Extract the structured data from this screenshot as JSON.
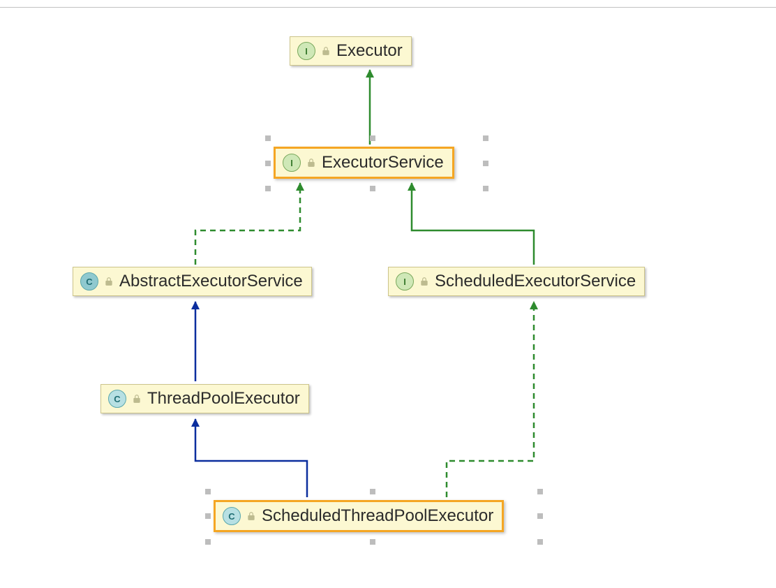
{
  "diagram": {
    "nodes": {
      "executor": {
        "label": "Executor",
        "kind": "I",
        "kind_name": "interface-icon",
        "selected": false
      },
      "executorService": {
        "label": "ExecutorService",
        "kind": "I",
        "kind_name": "interface-icon",
        "selected": true
      },
      "abstractExecutorService": {
        "label": "AbstractExecutorService",
        "kind": "C",
        "kind_name": "class-icon",
        "selected": false
      },
      "scheduledExecutorService": {
        "label": "ScheduledExecutorService",
        "kind": "I",
        "kind_name": "interface-icon",
        "selected": false
      },
      "threadPoolExecutor": {
        "label": "ThreadPoolExecutor",
        "kind": "C",
        "kind_name": "class-icon",
        "selected": false
      },
      "scheduledThreadPoolExecutor": {
        "label": "ScheduledThreadPoolExecutor",
        "kind": "C",
        "kind_name": "class-icon",
        "selected": true
      }
    },
    "edges": [
      {
        "from": "executorService",
        "to": "executor",
        "style": "solid",
        "color": "green",
        "relation": "extends-interface"
      },
      {
        "from": "abstractExecutorService",
        "to": "executorService",
        "style": "dashed",
        "color": "green",
        "relation": "implements"
      },
      {
        "from": "scheduledExecutorService",
        "to": "executorService",
        "style": "solid",
        "color": "green",
        "relation": "extends-interface"
      },
      {
        "from": "threadPoolExecutor",
        "to": "abstractExecutorService",
        "style": "solid",
        "color": "blue",
        "relation": "extends-class"
      },
      {
        "from": "scheduledThreadPoolExecutor",
        "to": "threadPoolExecutor",
        "style": "solid",
        "color": "blue",
        "relation": "extends-class"
      },
      {
        "from": "scheduledThreadPoolExecutor",
        "to": "scheduledExecutorService",
        "style": "dashed",
        "color": "green",
        "relation": "implements"
      }
    ],
    "colors": {
      "node_fill": "#fcf8d2",
      "node_border": "#ccc48a",
      "selected_border": "#f5a623",
      "edge_green": "#2e8b2e",
      "edge_blue": "#0b2e9e",
      "handle_gray": "#bdbdbd"
    }
  }
}
